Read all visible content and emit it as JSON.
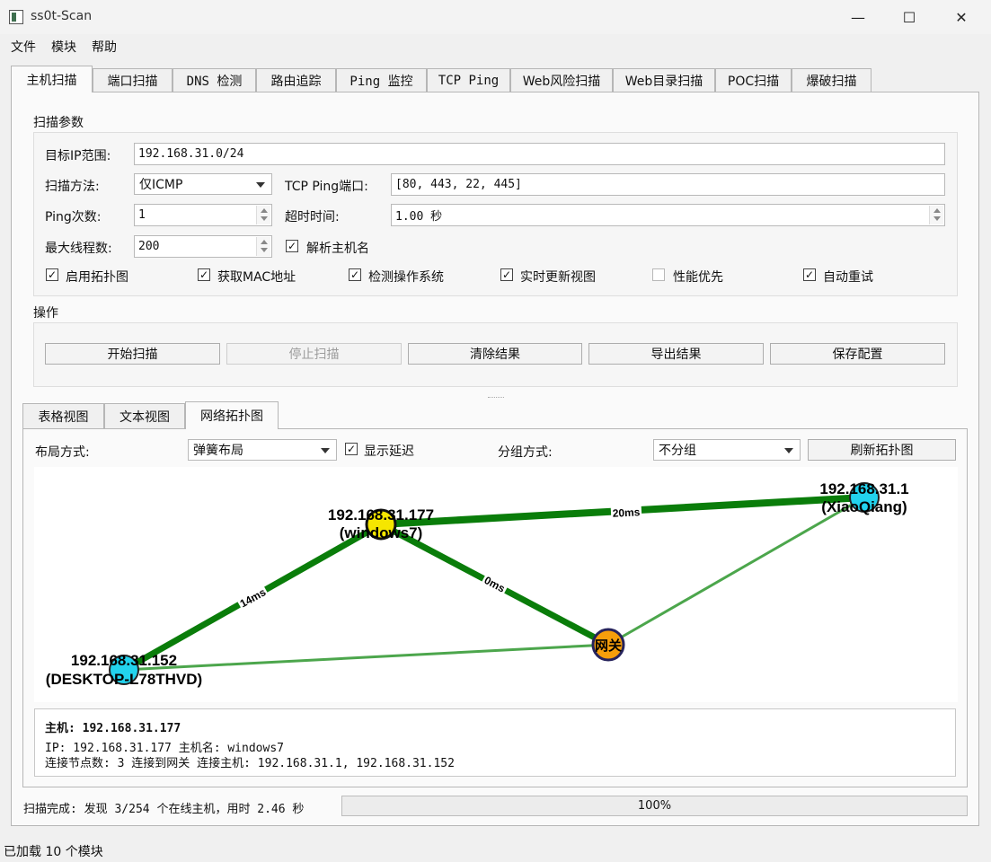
{
  "window": {
    "title": "ss0t-Scan",
    "minimize_glyph": "—",
    "maximize_glyph": "☐",
    "close_glyph": "✕"
  },
  "menu": [
    "文件",
    "模块",
    "帮助"
  ],
  "tabs": [
    "主机扫描",
    "端口扫描",
    "DNS 检测",
    "路由追踪",
    "Ping 监控",
    "TCP Ping",
    "Web风险扫描",
    "Web目录扫描",
    "POC扫描",
    "爆破扫描"
  ],
  "scan_params": {
    "title": "扫描参数",
    "target_label": "目标IP范围:",
    "target_value": "192.168.31.0/24",
    "method_label": "扫描方法:",
    "method_value": "仅ICMP",
    "tcp_ports_label": "TCP Ping端口:",
    "tcp_ports_value": "[80, 443, 22, 445]",
    "ping_count_label": "Ping次数:",
    "ping_count_value": "1",
    "timeout_label": "超时时间:",
    "timeout_value": "1.00 秒",
    "threads_label": "最大线程数:",
    "threads_value": "200",
    "resolve_hostname": {
      "label": "解析主机名",
      "checked": true
    },
    "checkboxes": [
      {
        "label": "启用拓扑图",
        "checked": true
      },
      {
        "label": "获取MAC地址",
        "checked": true
      },
      {
        "label": "检测操作系统",
        "checked": true
      },
      {
        "label": "实时更新视图",
        "checked": true
      },
      {
        "label": "性能优先",
        "checked": false
      },
      {
        "label": "自动重试",
        "checked": true
      }
    ]
  },
  "operations": {
    "title": "操作",
    "buttons": [
      "开始扫描",
      "停止扫描",
      "清除结果",
      "导出结果",
      "保存配置"
    ]
  },
  "view_tabs": [
    "表格视图",
    "文本视图",
    "网络拓扑图"
  ],
  "topology": {
    "layout_label": "布局方式:",
    "layout_value": "弹簧布局",
    "show_latency": {
      "label": "显示延迟",
      "checked": true
    },
    "group_label": "分组方式:",
    "group_value": "不分组",
    "refresh_button": "刷新拓扑图",
    "nodes": {
      "win7": {
        "label": "192.168.31.177",
        "sub": "(windows7)",
        "color": "#f5e600"
      },
      "xq": {
        "label": "192.168.31.1",
        "sub": "(XiaoQiang)",
        "color": "#22d3ee"
      },
      "gw": {
        "label": "网关",
        "color": "#f59e0b"
      },
      "desk": {
        "label": "192.168.31.152",
        "sub": "(DESKTOP-L78THVD)",
        "color": "#22d3ee"
      }
    },
    "edges": {
      "e1": "20ms",
      "e2": "0ms",
      "e3": "14ms"
    },
    "strong_edge_color": "#0a7d0a",
    "weak_edge_color": "#4ca64c"
  },
  "info": {
    "title": "主机: 192.168.31.177",
    "line1": "IP: 192.168.31.177  主机名: windows7",
    "line2": "连接节点数: 3  连接到网关 连接主机: 192.168.31.1, 192.168.31.152"
  },
  "status": {
    "summary": "扫描完成: 发现 3/254 个在线主机，用时 2.46 秒",
    "progress_text": "100%",
    "progress": 1.0,
    "bottom": "已加载 10 个模块"
  }
}
